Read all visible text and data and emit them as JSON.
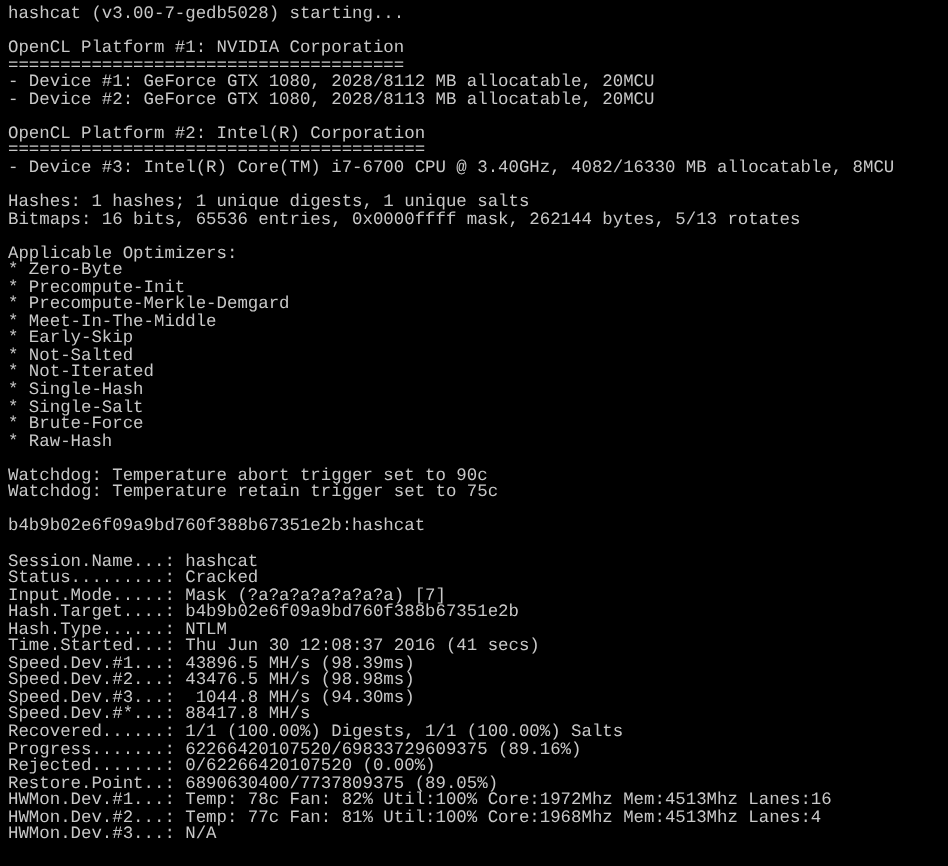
{
  "terminal": {
    "blocks": [
      {
        "lines": [
          "hashcat (v3.00-7-gedb5028) starting..."
        ]
      },
      {
        "lines": [
          "OpenCL Platform #1: NVIDIA Corporation",
          "======================================",
          "- Device #1: GeForce GTX 1080, 2028/8112 MB allocatable, 20MCU",
          "- Device #2: GeForce GTX 1080, 2028/8113 MB allocatable, 20MCU"
        ]
      },
      {
        "lines": [
          "OpenCL Platform #2: Intel(R) Corporation",
          "========================================",
          "- Device #3: Intel(R) Core(TM) i7-6700 CPU @ 3.40GHz, 4082/16330 MB allocatable, 8MCU"
        ]
      },
      {
        "lines": [
          "Hashes: 1 hashes; 1 unique digests, 1 unique salts",
          "Bitmaps: 16 bits, 65536 entries, 0x0000ffff mask, 262144 bytes, 5/13 rotates"
        ]
      },
      {
        "lines": [
          "Applicable Optimizers:",
          "* Zero-Byte",
          "* Precompute-Init",
          "* Precompute-Merkle-Demgard",
          "* Meet-In-The-Middle",
          "* Early-Skip",
          "* Not-Salted",
          "* Not-Iterated",
          "* Single-Hash",
          "* Single-Salt",
          "* Brute-Force",
          "* Raw-Hash"
        ]
      },
      {
        "lines": [
          "Watchdog: Temperature abort trigger set to 90c",
          "Watchdog: Temperature retain trigger set to 75c"
        ]
      },
      {
        "lines": [
          "b4b9b02e6f09a9bd760f388b67351e2b:hashcat"
        ]
      },
      {
        "lines": [
          "Session.Name...: hashcat",
          "Status.........: Cracked",
          "Input.Mode.....: Mask (?a?a?a?a?a?a?a) [7]",
          "Hash.Target....: b4b9b02e6f09a9bd760f388b67351e2b",
          "Hash.Type......: NTLM",
          "Time.Started...: Thu Jun 30 12:08:37 2016 (41 secs)",
          "Speed.Dev.#1...: 43896.5 MH/s (98.39ms)",
          "Speed.Dev.#2...: 43476.5 MH/s (98.98ms)",
          "Speed.Dev.#3...:  1044.8 MH/s (94.30ms)",
          "Speed.Dev.#*...: 88417.8 MH/s",
          "Recovered......: 1/1 (100.00%) Digests, 1/1 (100.00%) Salts",
          "Progress.......: 62266420107520/69833729609375 (89.16%)",
          "Rejected.......: 0/62266420107520 (0.00%)",
          "Restore.Point..: 6890630400/7737809375 (89.05%)",
          "HWMon.Dev.#1...: Temp: 78c Fan: 82% Util:100% Core:1972Mhz Mem:4513Mhz Lanes:16",
          "HWMon.Dev.#2...: Temp: 77c Fan: 81% Util:100% Core:1968Mhz Mem:4513Mhz Lanes:4",
          "HWMon.Dev.#3...: N/A"
        ]
      }
    ]
  }
}
